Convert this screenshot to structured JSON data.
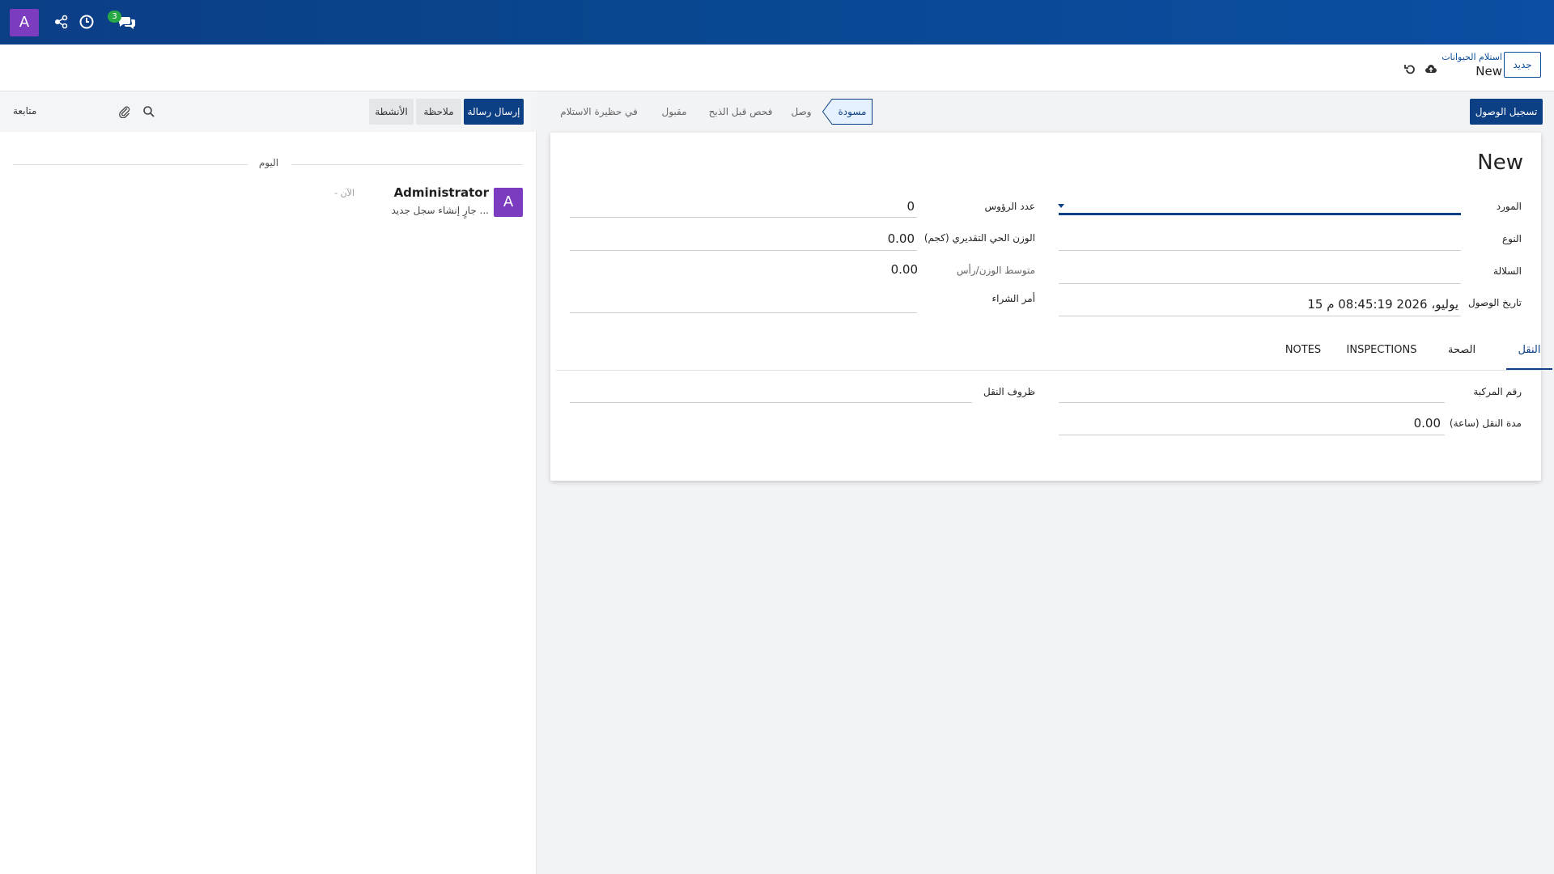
{
  "navbar": {
    "avatar_letter": "A",
    "icons": [
      "share-nodes-icon",
      "clock-icon",
      "chat-bubbles-icon"
    ],
    "chat_badge": "3"
  },
  "control_panel": {
    "new_button": "جديد",
    "breadcrumb_parent": "استلام الحيوانات",
    "breadcrumb_current": "New"
  },
  "chatter": {
    "send_message": "إرسال رسالة",
    "log_note": "ملاحظة",
    "activities": "الأنشطة",
    "follow": "متابعة",
    "date_separator": "اليوم",
    "message": {
      "avatar_letter": "A",
      "author": "Administrator",
      "time": "- الآن",
      "body": "جارٍ إنشاء سجل جديد ..."
    }
  },
  "form": {
    "register_arrival_button": "تسجيل الوصول",
    "statuses": [
      {
        "label": "مسودة",
        "active": true
      },
      {
        "label": "وصل",
        "active": false
      },
      {
        "label": "فحص قبل الذبح",
        "active": false
      },
      {
        "label": "مقبول",
        "active": false
      },
      {
        "label": "في حظيرة الاستلام",
        "active": false
      }
    ],
    "title": "New",
    "fields": {
      "supplier_label": "المورد",
      "type_label": "النوع",
      "breed_label": "السلالة",
      "arrival_date_label": "تاريخ الوصول",
      "arrival_date_value": "15 يوليو، 2026 08:45:19 م",
      "head_count_label": "عدد الرؤوس",
      "head_count_value": "0",
      "live_weight_label": "الوزن الحي التقديري (كجم)",
      "live_weight_value": "0.00",
      "avg_weight_label": "متوسط الوزن/رأس",
      "avg_weight_value": "0.00",
      "purchase_order_label": "أمر الشراء"
    },
    "tabs": [
      {
        "label": "النقل",
        "active": true
      },
      {
        "label": "الصحة",
        "active": false
      },
      {
        "label": "INSPECTIONS",
        "active": false
      },
      {
        "label": "NOTES",
        "active": false
      }
    ],
    "transport": {
      "vehicle_number_label": "رقم المركبة",
      "duration_label": "مدة النقل (ساعة)",
      "duration_value": "0.00",
      "conditions_label": "ظروف النقل"
    }
  }
}
